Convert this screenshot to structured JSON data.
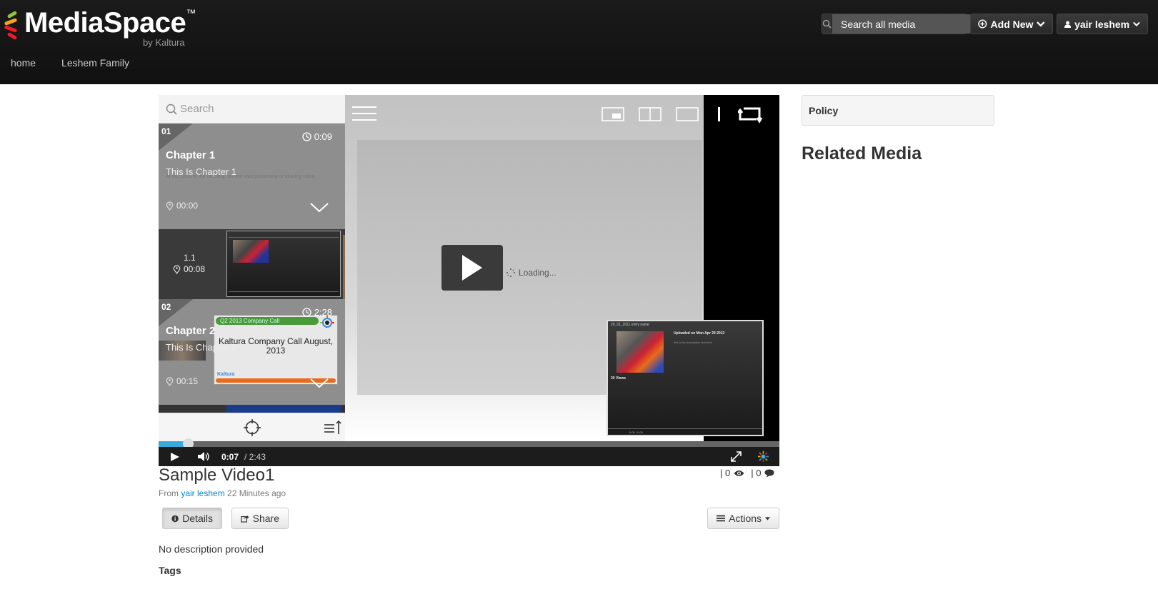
{
  "header": {
    "logo_text": "MediaSpace",
    "logo_tm": "™",
    "logo_sub": "by Kaltura",
    "search_placeholder": "Search all media",
    "add_new_label": "Add New",
    "user_label": "yair leshem",
    "nav": [
      "home",
      "Leshem Family"
    ]
  },
  "player": {
    "search_placeholder": "Search",
    "chapters": [
      {
        "num": "01",
        "duration": "0:09",
        "title": "Chapter 1",
        "description": "This Is Chapter 1",
        "small_text": "At this point in the meeting, no one was presenting or sharing video.",
        "time": "00:00"
      },
      {
        "num": "02",
        "duration": "2:28",
        "title": "Chapter 2",
        "description": "This Is Chapter 2",
        "time": "00:15",
        "slide_banner": "Q2 2013 Company Call",
        "slide_title": "Kaltura Company Call August, 2013",
        "slide_footer": "Kaltura"
      }
    ],
    "slide": {
      "num": "1.1",
      "time": "00:08"
    },
    "thumb": {
      "entry": "20_01_2011 entry name",
      "uploaded": "Uploaded on Mon Apr 29 2013",
      "desc": "this is the description text here",
      "views": "20 Views",
      "time": "0:00 / 0:00"
    },
    "loading_text": "Loading...",
    "current_time": "0:07",
    "total_time": "/ 2:43",
    "progress": 0.046
  },
  "media": {
    "title": "Sample Video1",
    "from_label": "From",
    "author": "yair leshem",
    "ago": "22 Minutes ago",
    "views_count": "| 0",
    "comments_count": "| 0",
    "details_label": "Details",
    "share_label": "Share",
    "actions_label": "Actions",
    "description": "No description provided",
    "tags_heading": "Tags"
  },
  "sidebar": {
    "policy_label": "Policy",
    "related_heading": "Related Media"
  }
}
